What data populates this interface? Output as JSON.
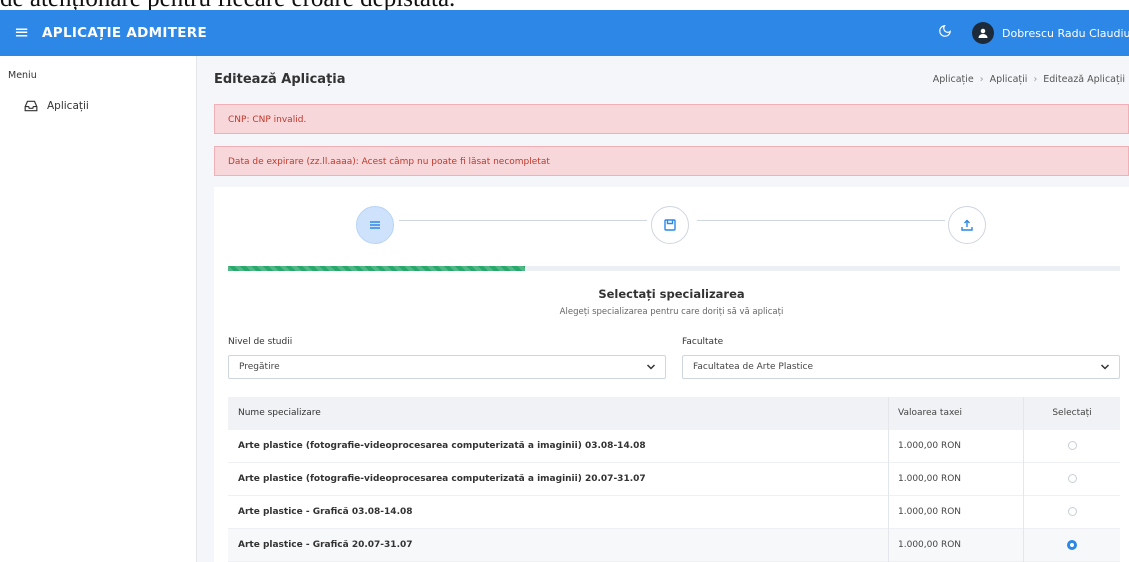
{
  "caption": {
    "text": "de atenționare pentru fiecare eroare depistată."
  },
  "navbar": {
    "brand": "APLICAȚIE ADMITERE",
    "user_name": "Dobrescu Radu Claudiu",
    "background": "#2c87e6"
  },
  "sidebar": {
    "heading": "Meniu",
    "items": [
      {
        "label": "Aplicații",
        "icon": "inbox-icon"
      }
    ]
  },
  "page": {
    "title": "Editează Aplicația",
    "breadcrumb": [
      "Aplicație",
      "Aplicații",
      "Editează Aplicații"
    ]
  },
  "alerts": [
    "CNP: CNP invalid.",
    "Data de expirare (zz.ll.aaaa): Acest câmp nu poate fi lăsat necompletat"
  ],
  "wizard": {
    "steps": [
      {
        "icon": "list-icon",
        "state": "active"
      },
      {
        "icon": "save-icon",
        "state": "inactive"
      },
      {
        "icon": "upload-icon",
        "state": "inactive"
      }
    ],
    "progress": 0.333,
    "progress_color": "#29a86b"
  },
  "section": {
    "title": "Selectați specializarea",
    "subtitle": "Alegeți specializarea pentru care doriți să vă aplicați"
  },
  "form": {
    "level_label": "Nivel de studii",
    "level_value": "Pregătire",
    "faculty_label": "Facultate",
    "faculty_value": "Facultatea de Arte Plastice"
  },
  "table": {
    "headers": [
      "Nume specializare",
      "Valoarea taxei",
      "Selectați"
    ],
    "rows": [
      {
        "name": "Arte plastice (fotografie-videoprocesarea computerizată a imaginii) 03.08-14.08",
        "fee": "1.000,00 RON",
        "selected": false
      },
      {
        "name": "Arte plastice (fotografie-videoprocesarea computerizată a imaginii) 20.07-31.07",
        "fee": "1.000,00 RON",
        "selected": false
      },
      {
        "name": "Arte plastice - Grafică 03.08-14.08",
        "fee": "1.000,00 RON",
        "selected": false
      },
      {
        "name": "Arte plastice - Grafică 20.07-31.07",
        "fee": "1.000,00 RON",
        "selected": true
      }
    ]
  }
}
